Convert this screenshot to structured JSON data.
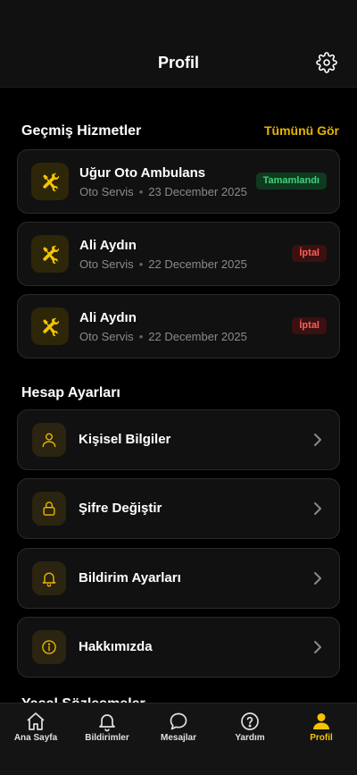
{
  "header": {
    "title": "Profil",
    "settings_icon": "gear-icon"
  },
  "past_services": {
    "title": "Geçmiş Hizmetler",
    "see_all": "Tümünü Gör",
    "items": [
      {
        "name": "Uğur Oto Ambulans",
        "type": "Oto Servis",
        "date": "23 December 2025",
        "status": "Tamamlandı",
        "status_kind": "completed",
        "icon": "tools-icon"
      },
      {
        "name": "Ali Aydın",
        "type": "Oto Servis",
        "date": "22 December 2025",
        "status": "İptal",
        "status_kind": "cancelled",
        "icon": "tools-icon"
      },
      {
        "name": "Ali Aydın",
        "type": "Oto Servis",
        "date": "22 December 2025",
        "status": "İptal",
        "status_kind": "cancelled",
        "icon": "tools-icon"
      }
    ]
  },
  "account_settings": {
    "title": "Hesap Ayarları",
    "items": [
      {
        "label": "Kişisel Bilgiler",
        "icon": "user-icon"
      },
      {
        "label": "Şifre Değiştir",
        "icon": "lock-icon"
      },
      {
        "label": "Bildirim Ayarları",
        "icon": "bell-icon"
      },
      {
        "label": "Hakkımızda",
        "icon": "info-icon"
      }
    ]
  },
  "legal": {
    "title": "Yasal Sözleşmeler"
  },
  "bottom_nav": {
    "items": [
      {
        "label": "Ana Sayfa",
        "icon": "home-icon",
        "active": false
      },
      {
        "label": "Bildirimler",
        "icon": "bell-icon",
        "active": false
      },
      {
        "label": "Mesajlar",
        "icon": "chat-icon",
        "active": false
      },
      {
        "label": "Yardım",
        "icon": "help-icon",
        "active": false
      },
      {
        "label": "Profil",
        "icon": "profile-icon",
        "active": true
      }
    ]
  },
  "colors": {
    "accent": "#f5c400",
    "background": "#000000",
    "card": "#111111",
    "success": "#3ed37a",
    "danger": "#ff5c5c"
  }
}
